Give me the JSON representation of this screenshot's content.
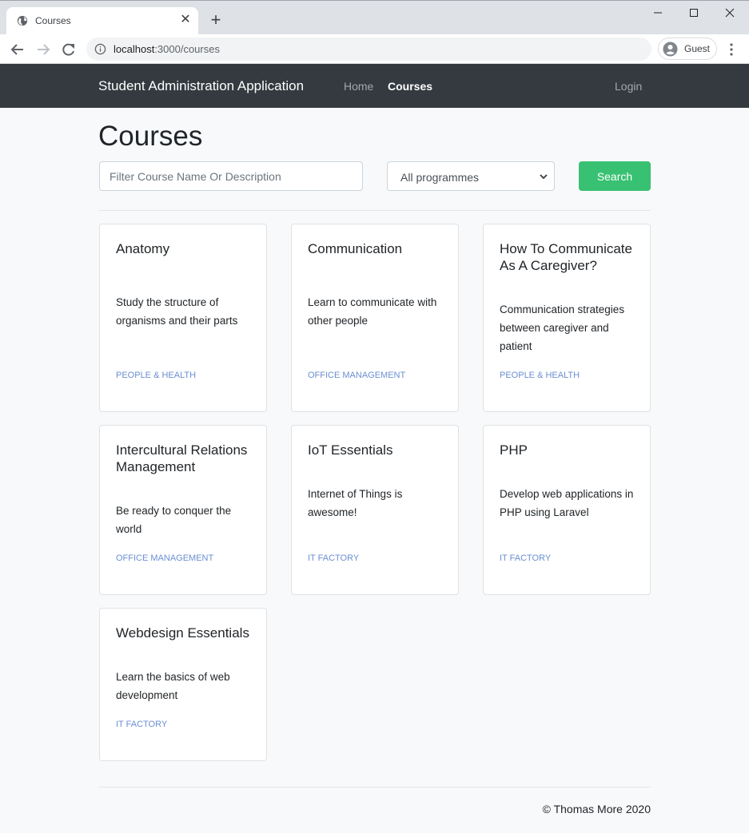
{
  "browser": {
    "tab_title": "Courses",
    "url_host": "localhost",
    "url_path": ":3000/courses",
    "profile_label": "Guest"
  },
  "navbar": {
    "brand": "Student Administration Application",
    "links": [
      {
        "label": "Home",
        "active": false
      },
      {
        "label": "Courses",
        "active": true
      }
    ],
    "login_label": "Login"
  },
  "page": {
    "title": "Courses",
    "filter_placeholder": "Filter Course Name Or Description",
    "filter_value": "",
    "programme_selected": "All programmes",
    "search_label": "Search"
  },
  "courses": [
    {
      "name": "Anatomy",
      "description": "Study the structure of organisms and their parts",
      "programme": "PEOPLE & HEALTH"
    },
    {
      "name": "Communication",
      "description": "Learn to communicate with other people",
      "programme": "OFFICE MANAGEMENT"
    },
    {
      "name": "How To Communicate As A Caregiver?",
      "description": "Communication strategies between caregiver and patient",
      "programme": "PEOPLE & HEALTH"
    },
    {
      "name": "Intercultural Relations Management",
      "description": "Be ready to conquer the world",
      "programme": "OFFICE MANAGEMENT"
    },
    {
      "name": "IoT Essentials",
      "description": "Internet of Things is awesome!",
      "programme": "IT FACTORY"
    },
    {
      "name": "PHP",
      "description": "Develop web applications in PHP using Laravel",
      "programme": "IT FACTORY"
    },
    {
      "name": "Webdesign Essentials",
      "description": "Learn the basics of web development",
      "programme": "IT FACTORY"
    }
  ],
  "footer": {
    "text": "© Thomas More 2020"
  },
  "colors": {
    "navbar_bg": "#343a40",
    "search_button": "#38c172",
    "programme_link": "#6a8fd3",
    "page_bg": "#f8f9fa"
  }
}
